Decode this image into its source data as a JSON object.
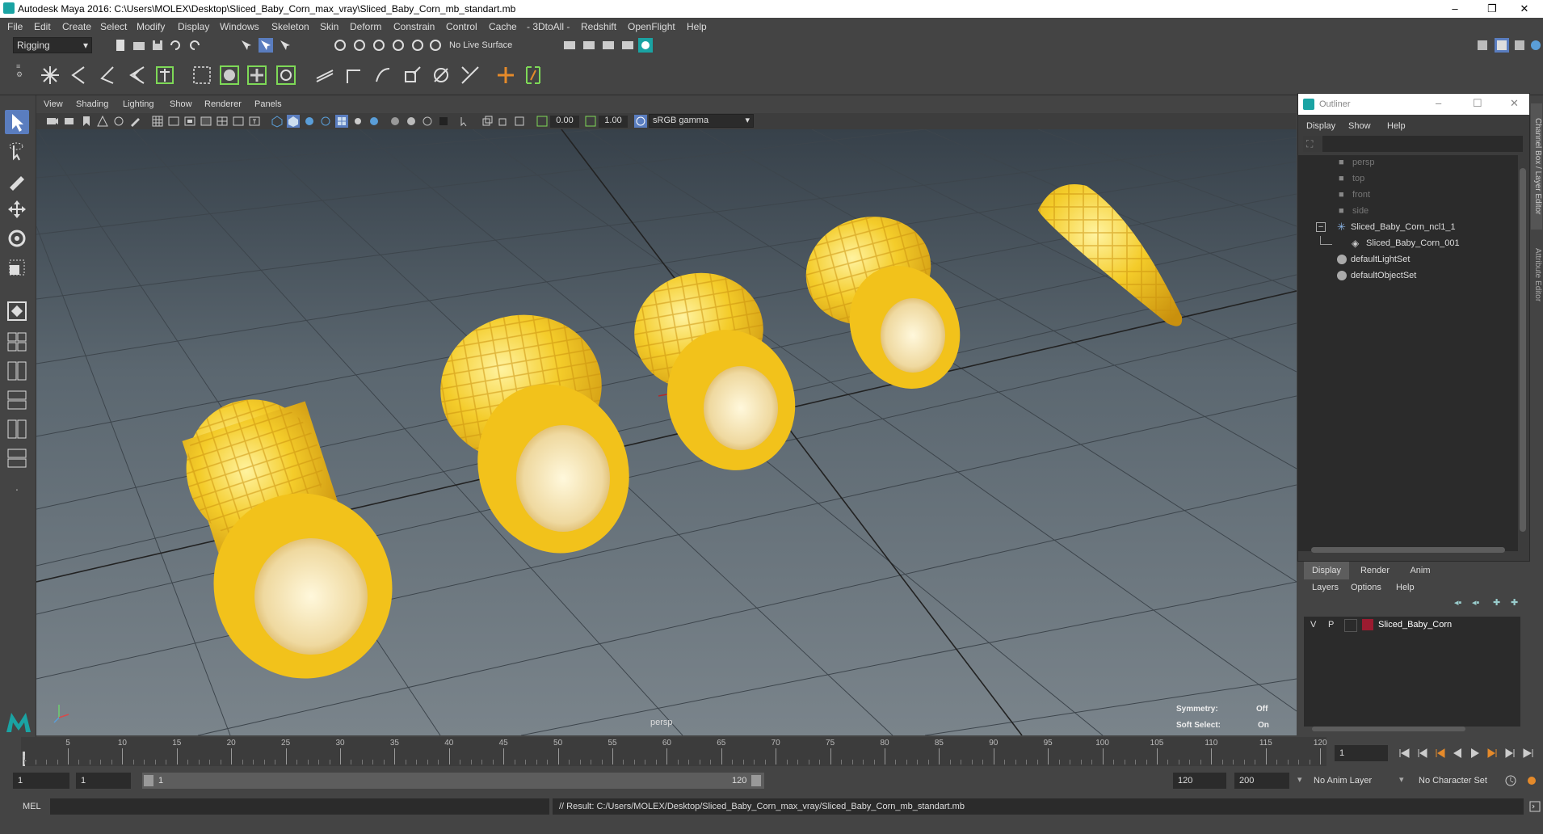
{
  "window": {
    "title": "Autodesk Maya 2016: C:\\Users\\MOLEX\\Desktop\\Sliced_Baby_Corn_max_vray\\Sliced_Baby_Corn_mb_standart.mb",
    "minimize": "–",
    "restore": "❐",
    "close": "✕"
  },
  "menubar": [
    "File",
    "Edit",
    "Create",
    "Select",
    "Modify",
    "Display",
    "Windows",
    "Skeleton",
    "Skin",
    "Deform",
    "Constrain",
    "Control",
    "Cache",
    "- 3DtoAll -",
    "Redshift",
    "OpenFlight",
    "Help"
  ],
  "statusline": {
    "mode": "Rigging",
    "live_surface": "No Live Surface"
  },
  "viewport": {
    "menu": [
      "View",
      "Shading",
      "Lighting",
      "Show",
      "Renderer",
      "Panels"
    ],
    "exposure": "0.00",
    "gamma": "1.00",
    "colorspace": "sRGB gamma",
    "camera_label": "persp",
    "symmetry_label": "Symmetry:",
    "symmetry_value": "Off",
    "soft_select_label": "Soft Select:",
    "soft_select_value": "On"
  },
  "outliner": {
    "title": "Outliner",
    "menu": [
      "Display",
      "Show",
      "Help"
    ],
    "items": [
      {
        "label": "persp",
        "dim": true
      },
      {
        "label": "top",
        "dim": true
      },
      {
        "label": "front",
        "dim": true
      },
      {
        "label": "side",
        "dim": true
      },
      {
        "label": "Sliced_Baby_Corn_ncl1_1",
        "dim": false
      },
      {
        "label": "Sliced_Baby_Corn_001",
        "dim": false
      },
      {
        "label": "defaultLightSet",
        "dim": false
      },
      {
        "label": "defaultObjectSet",
        "dim": false
      }
    ]
  },
  "layer_editor": {
    "tabs": [
      "Display",
      "Render",
      "Anim"
    ],
    "menu": [
      "Layers",
      "Options",
      "Help"
    ],
    "layer": {
      "v": "V",
      "p": "P",
      "name": "Sliced_Baby_Corn",
      "color": "#9b1b30"
    }
  },
  "timeline": {
    "ticks": [
      "5",
      "10",
      "15",
      "20",
      "25",
      "30",
      "35",
      "40",
      "45",
      "50",
      "55",
      "60",
      "65",
      "70",
      "75",
      "80",
      "85",
      "90",
      "95",
      "100",
      "105",
      "110",
      "115",
      "120"
    ],
    "first_tick": "1",
    "current_frame": "1"
  },
  "range": {
    "start": "1",
    "start2": "1",
    "slider_start": "1",
    "slider_end": "120",
    "end": "120",
    "end2": "200",
    "anim_layer": "No Anim Layer",
    "char_set": "No Character Set"
  },
  "cmdline": {
    "lang": "MEL",
    "result": "// Result: C:/Users/MOLEX/Desktop/Sliced_Baby_Corn_max_vray/Sliced_Baby_Corn_mb_standart.mb"
  },
  "side_tabs": {
    "channel": "Channel Box / Layer Editor",
    "attr": "Attribute Editor"
  },
  "colors": {
    "accent": "#5a7dbf",
    "maya_teal": "#1aa3a3",
    "corn": "#f2c21b"
  }
}
